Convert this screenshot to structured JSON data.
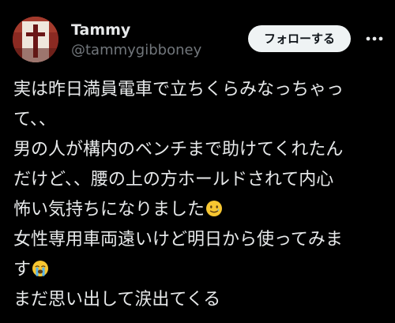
{
  "author": {
    "display_name": "Tammy",
    "handle": "@tammygibboney"
  },
  "actions": {
    "follow_label": "フォローする",
    "more_icon": "more-horizontal-icon"
  },
  "tweet": {
    "lines": [
      "実は昨日満員電車で立ちくらみなっちゃっ",
      "て、、",
      "男の人が構内のベンチまで助けてくれたん",
      "だけど、、腰の上の方ホールドされて内心",
      "怖い気持ちになりました",
      "女性専用車両遠いけど明日から使ってみま",
      "す",
      "まだ思い出して涙出てくる"
    ],
    "emojis": {
      "line_5": "smiling-face-with-tear-emoji",
      "line_7": "loudly-crying-face-emoji"
    }
  },
  "colors": {
    "background": "#000000",
    "text_primary": "#e7e9ea",
    "text_secondary": "#71767b",
    "follow_button_bg": "#eff3f4",
    "follow_button_text": "#0f1419"
  }
}
